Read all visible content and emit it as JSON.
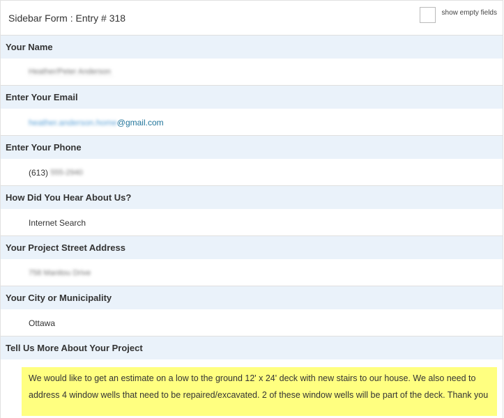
{
  "header": {
    "title": "Sidebar Form : Entry # 318",
    "show_empty_label": "show empty fields",
    "show_empty_checked": false
  },
  "fields": [
    {
      "label": "Your Name",
      "value": "Heather/Peter Anderson"
    },
    {
      "label": "Enter Your Email",
      "value_masked": "heather.anderson.home",
      "value_visible": "@gmail.com"
    },
    {
      "label": "Enter Your Phone",
      "value_visible": "(613)",
      "value_masked": "555-2940"
    },
    {
      "label": "How Did You Hear About Us?",
      "value": "Internet Search"
    },
    {
      "label": "Your Project Street Address",
      "value": "758 Manitou Drive"
    },
    {
      "label": "Your City or Municipality",
      "value": "Ottawa"
    },
    {
      "label": "Tell Us More About Your Project",
      "value": "We would like to get an estimate on a low to the ground 12' x 24' deck with new stairs to our house. We also need to address 4 window wells that need to be repaired/excavated. 2 of these window wells will be part of the deck. Thank you"
    }
  ],
  "colors": {
    "label_bg": "#eaf2fa",
    "highlight_bg": "#ffff80",
    "link": "#21759b"
  }
}
